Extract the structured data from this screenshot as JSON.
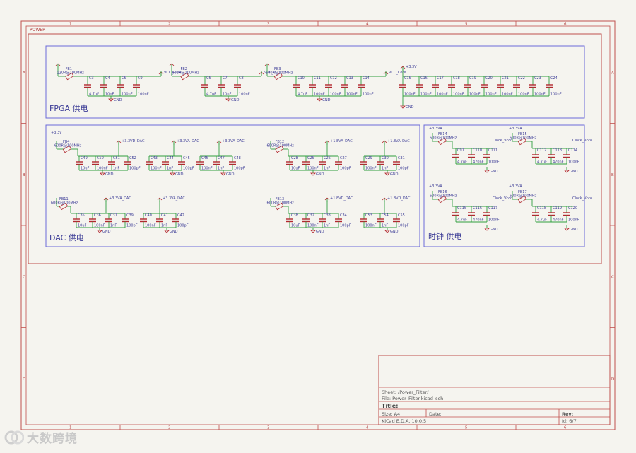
{
  "sheet_label": "POWER",
  "border": {
    "cols": [
      "1",
      "2",
      "3",
      "4",
      "5",
      "6"
    ],
    "rows": [
      "A",
      "B",
      "C",
      "D"
    ]
  },
  "groups": {
    "fpga": "FPGA 供电",
    "dac": "DAC 供电",
    "clock": "时钟 供电"
  },
  "fpga": {
    "blocks": [
      {
        "fb": "FB1",
        "fbval": "120R@100MHz",
        "net": "VCC_PLLR",
        "caps": [
          "C3",
          "C4",
          "C5",
          "C9"
        ],
        "vals": [
          "4.7uF",
          "10nF",
          "100nF",
          "100nF"
        ]
      },
      {
        "fb": "FB2",
        "fbval": "600R@100MHz",
        "net": "VCC_PLLL",
        "caps": [
          "C6",
          "C7",
          "C8"
        ],
        "vals": [
          "4.7uF",
          "10nF",
          "100nF"
        ]
      },
      {
        "fb": "FB3",
        "fbval": "600R@100MHz",
        "net": "VCC_Core",
        "caps": [
          "C10",
          "C11",
          "C12",
          "C13",
          "C14"
        ],
        "vals": [
          "4.7uF",
          "100nF",
          "100nF",
          "100nF",
          "100nF"
        ]
      }
    ],
    "rail": {
      "net": "+3.3V",
      "caps": [
        "C15",
        "C16",
        "C17",
        "C18",
        "C19",
        "C20",
        "C21",
        "C22",
        "C23",
        "C24"
      ],
      "vals": [
        "100nF",
        "100nF",
        "100nF",
        "100nF",
        "100nF",
        "100nF",
        "100nF",
        "100nF",
        "100nF",
        "100nF"
      ]
    },
    "gnd": "GND"
  },
  "dac": {
    "top_left_in": "+3.3V",
    "rows": [
      {
        "fb": "FB4",
        "fbval": "600R@100MHz",
        "groups": [
          {
            "net": "+3.3VD_DAC",
            "caps": [
              "C49",
              "C50",
              "C51",
              "C52"
            ],
            "vals": [
              "10uF",
              "100nF",
              "1nF",
              "100pF"
            ]
          },
          {
            "net": "+3.3VA_DAC",
            "caps": [
              "C43",
              "C44",
              "C45"
            ],
            "vals": [
              "100nF",
              "1nF",
              "100pF"
            ]
          },
          {
            "net": "+3.3VA_DAC",
            "caps": [
              "C46",
              "C47",
              "C48"
            ],
            "vals": [
              "100nF",
              "1nF",
              "100pF"
            ]
          }
        ]
      },
      {
        "fb": "FB11",
        "fbval": "600R@100MHz",
        "groups": [
          {
            "net": "+3.3VA_DAC",
            "caps": [
              "C35",
              "C36",
              "C37",
              "C39"
            ],
            "vals": [
              "10uF",
              "100nF",
              "1nF",
              "100pF"
            ]
          },
          {
            "net": "+3.3VA_DAC",
            "caps": [
              "C40",
              "C41",
              "C42"
            ],
            "vals": [
              "100nF",
              "1nF",
              "100pF"
            ]
          }
        ]
      },
      {
        "fb": "FB12",
        "fbval": "600R@100MHz",
        "groups": [
          {
            "net": "+1.8VA_DAC",
            "caps": [
              "C28",
              "C25",
              "C26",
              "C27"
            ],
            "vals": [
              "10uF",
              "100nF",
              "1nF",
              "100pF"
            ]
          },
          {
            "net": "+1.8VA_DAC",
            "caps": [
              "C29",
              "C30",
              "C31"
            ],
            "vals": [
              "100nF",
              "1nF",
              "100pF"
            ]
          }
        ]
      },
      {
        "fb": "FB13",
        "fbval": "600R@100MHz",
        "groups": [
          {
            "net": "+1.8VD_DAC",
            "caps": [
              "C38",
              "C32",
              "C33",
              "C34"
            ],
            "vals": [
              "10uF",
              "100nF",
              "1nF",
              "100pF"
            ]
          },
          {
            "net": "+1.8VD_DAC",
            "caps": [
              "C53",
              "C54",
              "C55"
            ],
            "vals": [
              "100nF",
              "1nF",
              "100pF"
            ]
          }
        ]
      }
    ]
  },
  "clock": {
    "blocks": [
      {
        "in": "+3.3VA",
        "fb": "FB14",
        "fbval": "600R@100MHz",
        "net": "Clock_Vcco",
        "caps": [
          "C97",
          "C110",
          "C111"
        ],
        "vals": [
          "4.7uF",
          "470nF",
          "100nF"
        ]
      },
      {
        "in": "+3.3VA",
        "fb": "FB15",
        "fbval": "600R@100MHz",
        "net": "Clock_Vcco",
        "caps": [
          "C112",
          "C113",
          "C114"
        ],
        "vals": [
          "4.7uF",
          "470nF",
          "100nF"
        ]
      },
      {
        "in": "+3.3VA",
        "fb": "FB16",
        "fbval": "600R@100MHz",
        "net": "Clock_Vcco",
        "caps": [
          "C115",
          "C116",
          "C117"
        ],
        "vals": [
          "4.7uF",
          "470nF",
          "100nF"
        ]
      },
      {
        "in": "+3.3VA",
        "fb": "FB17",
        "fbval": "600R@100MHz",
        "net": "Clock_Vcco",
        "caps": [
          "C118",
          "C119",
          "C120"
        ],
        "vals": [
          "4.7uF",
          "470nF",
          "100nF"
        ]
      }
    ]
  },
  "title_block": {
    "sheet": "Sheet: /Power_Filter/",
    "file": "File: Power_Filter.kicad_sch",
    "title": "Title:",
    "size": "Size: A4",
    "date": "Date:",
    "rev": "Rev:",
    "tool": "KiCad E.D.A. 10.0.5",
    "id": "Id: 6/7"
  },
  "watermark": "大数跨境",
  "colors": {
    "border": "#c0504d",
    "block": "#6a6ad8",
    "wire": "#2e9e3e",
    "cap": "#b2282f",
    "label": "#1f5e8c",
    "text": "#3c3c96"
  }
}
